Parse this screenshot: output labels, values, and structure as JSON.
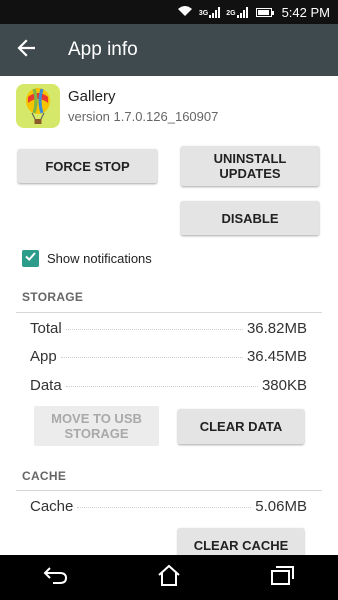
{
  "status_bar": {
    "network_1": "3G",
    "network_2": "2G",
    "time": "5:42 PM"
  },
  "toolbar": {
    "title": "App info"
  },
  "app": {
    "name": "Gallery",
    "version": "version 1.7.0.126_160907"
  },
  "buttons": {
    "force_stop": "FORCE STOP",
    "uninstall_updates": "UNINSTALL UPDATES",
    "disable": "DISABLE",
    "move_to_usb": "MOVE TO USB STORAGE",
    "clear_data": "CLEAR DATA",
    "clear_cache": "CLEAR CACHE"
  },
  "notifications": {
    "label": "Show notifications",
    "checked": true
  },
  "storage": {
    "header": "STORAGE",
    "rows": [
      {
        "label": "Total",
        "value": "36.82MB"
      },
      {
        "label": "App",
        "value": "36.45MB"
      },
      {
        "label": "Data",
        "value": "380KB"
      }
    ]
  },
  "cache": {
    "header": "CACHE",
    "rows": [
      {
        "label": "Cache",
        "value": "5.06MB"
      }
    ]
  },
  "colors": {
    "toolbar": "#3f4a4e",
    "accent": "#2e9c8b",
    "status_bar": "#111111",
    "nav_bar": "#000000"
  },
  "icons": [
    "wifi-icon",
    "signal-icon",
    "battery-icon",
    "back-arrow-icon",
    "hot-air-balloon-icon",
    "nav-back-icon",
    "nav-home-icon",
    "nav-recents-icon"
  ]
}
